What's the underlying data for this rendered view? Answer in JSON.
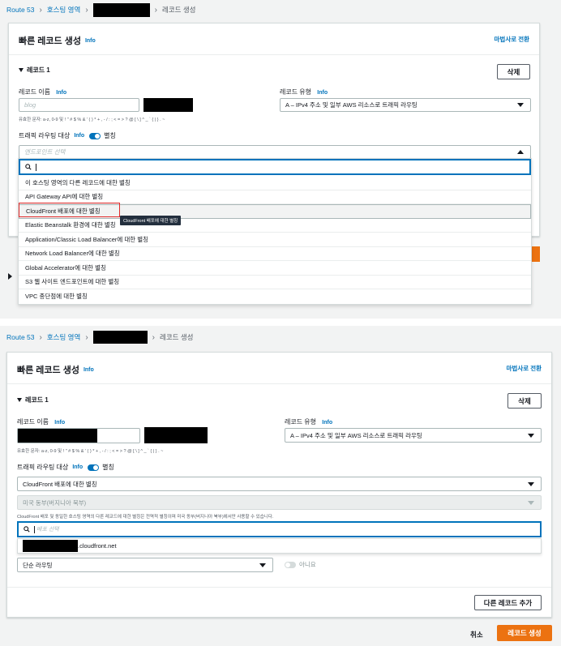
{
  "top": {
    "breadcrumb": {
      "route53": "Route 53",
      "zones": "호스팅 영역",
      "current": "레코드 생성"
    },
    "header": {
      "title": "빠른 레코드 생성",
      "info": "Info",
      "wizard_link": "마법사로 전환"
    },
    "record": {
      "section_title": "레코드 1",
      "delete_button": "삭제",
      "name_label": "레코드 이름",
      "name_info": "Info",
      "name_placeholder": "blog",
      "name_hint": "유효한 문자: a-z, 0-9 및 ! \" # $ % & ' ( ) * + , - / : ; < = > ? @ [ \\ ] ^ _ ` { | } . ~",
      "type_label": "레코드 유형",
      "type_info": "Info",
      "type_value": "A – IPv4 주소 및 일부 AWS 리소스로 트래픽 라우팅",
      "target_label": "트래픽 라우팅 대상",
      "target_info": "Info",
      "alias_label": "별칭",
      "endpoint_placeholder": "엔드포인트 선택"
    },
    "dropdown": {
      "options": [
        "이 호스팅 영역의 다른 레코드에 대한 별칭",
        "API Gateway API에 대한 별칭",
        "CloudFront 배포에 대한 별칭",
        "Elastic Beanstalk 환경에 대한 별칭",
        "Application/Classic Load Balancer에 대한 별칭",
        "Network Load Balancer에 대한 별칭",
        "Global Accelerator에 대한 별칭",
        "S3 웹 사이트 엔드포인트에 대한 별칭",
        "VPC 종단점에 대한 별칭"
      ],
      "tooltip": "CloudFront 배포에 대한 별칭"
    }
  },
  "bottom": {
    "breadcrumb": {
      "route53": "Route 53",
      "zones": "호스팅 영역",
      "current": "레코드 생성"
    },
    "header": {
      "title": "빠른 레코드 생성",
      "info": "Info",
      "wizard_link": "마법사로 전환"
    },
    "record": {
      "section_title": "레코드 1",
      "delete_button": "삭제",
      "name_label": "레코드 이름",
      "name_info": "Info",
      "name_hint": "유효한 문자: a-z, 0-9 및 ! \" # $ % & ' ( ) * + , - / : ; < = > ? @ [ \\ ] ^ _ ` { | } . ~",
      "type_label": "레코드 유형",
      "type_info": "Info",
      "type_value": "A – IPv4 주소 및 일부 AWS 리소스로 트래픽 라우팅",
      "target_label": "트래픽 라우팅 대상",
      "target_info": "Info",
      "alias_label": "별칭",
      "target_value": "CloudFront 배포에 대한 별칭",
      "region_value": "미국 동부(버지니아 북부)",
      "cf_note": "CloudFront 배포 및 동일한 호스팅 영역의 다른 레코드에 대한 별칭은 전역적 별칭이며 미국 동부(버지니아 북부)에서만 사용할 수 있습니다.",
      "dist_placeholder": "배포 선택",
      "dist_option": ".cloudfront.net",
      "routing_value": "단순 라우팅",
      "health_value": "아니요",
      "add_record_button": "다른 레코드 추가"
    },
    "footer": {
      "cancel": "취소",
      "create": "레코드 생성"
    }
  }
}
